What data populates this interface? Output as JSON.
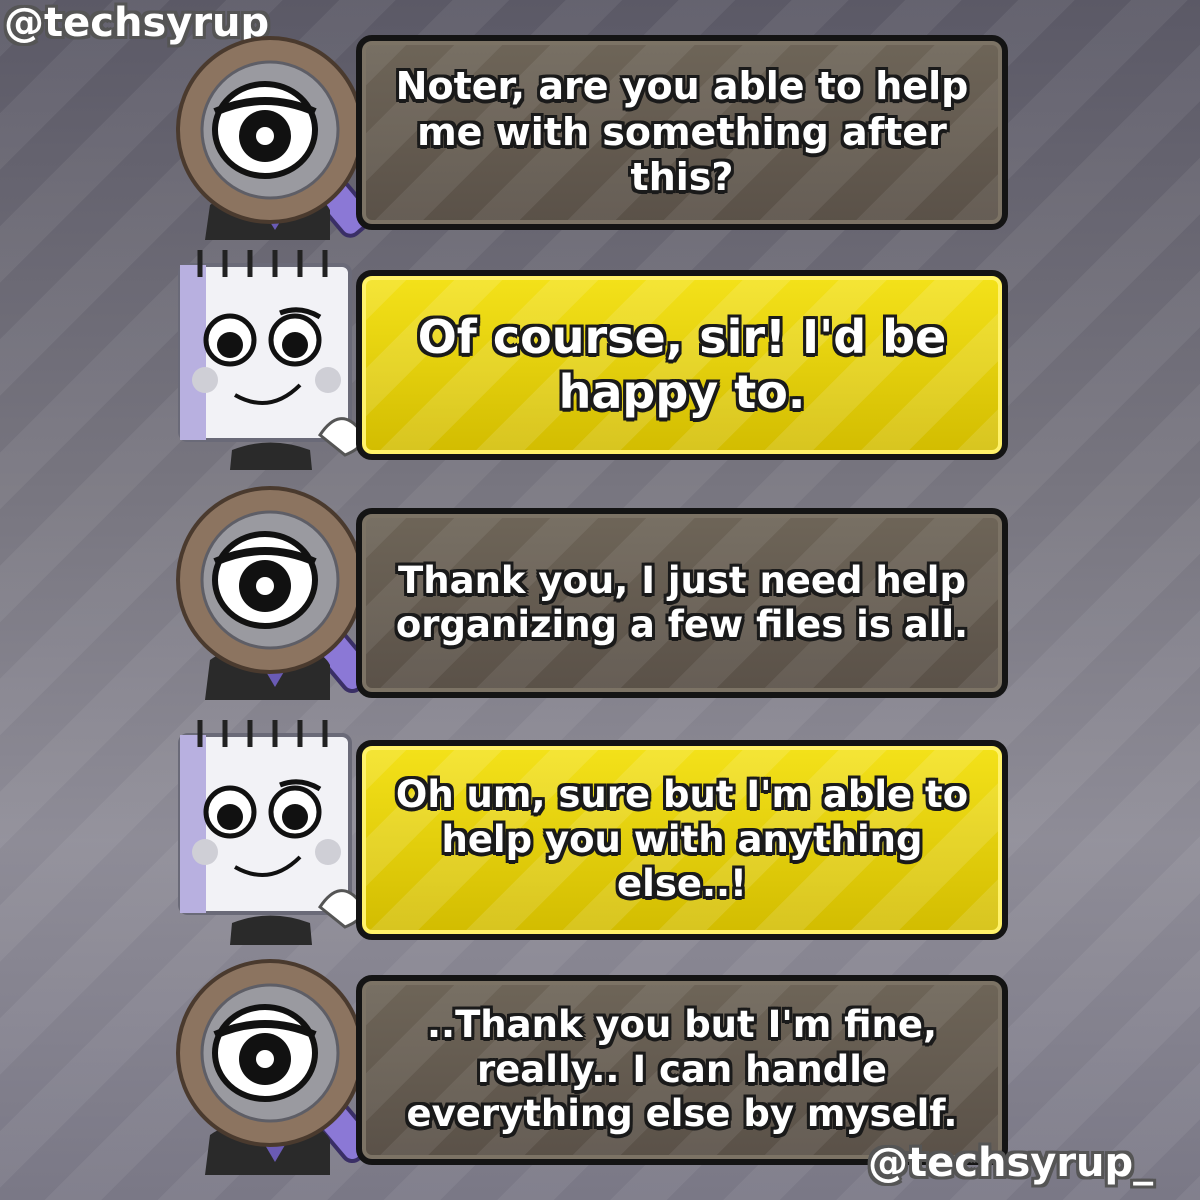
{
  "watermarks": {
    "top": "@techsyrup_",
    "bottom": "@techsyrup_"
  },
  "dialogue": [
    {
      "speaker": "magnifier",
      "style": "brown",
      "text": "Noter, are you able to help me with something after this?"
    },
    {
      "speaker": "notepad",
      "style": "yellow",
      "text": "Of course, sir! I'd be happy to."
    },
    {
      "speaker": "magnifier",
      "style": "brown",
      "text": "Thank you, I just need help organizing a few files is all."
    },
    {
      "speaker": "notepad",
      "style": "yellow",
      "text": "Oh um, sure but I'm able to help you with anything else..!"
    },
    {
      "speaker": "magnifier",
      "style": "brown",
      "text": "..Thank you but I'm fine, really.. I can handle everything else by myself."
    }
  ],
  "colors": {
    "brown_bubble": "#5f564c",
    "yellow_bubble": "#e6d20c",
    "outline": "#141414",
    "text": "#ffffff"
  }
}
